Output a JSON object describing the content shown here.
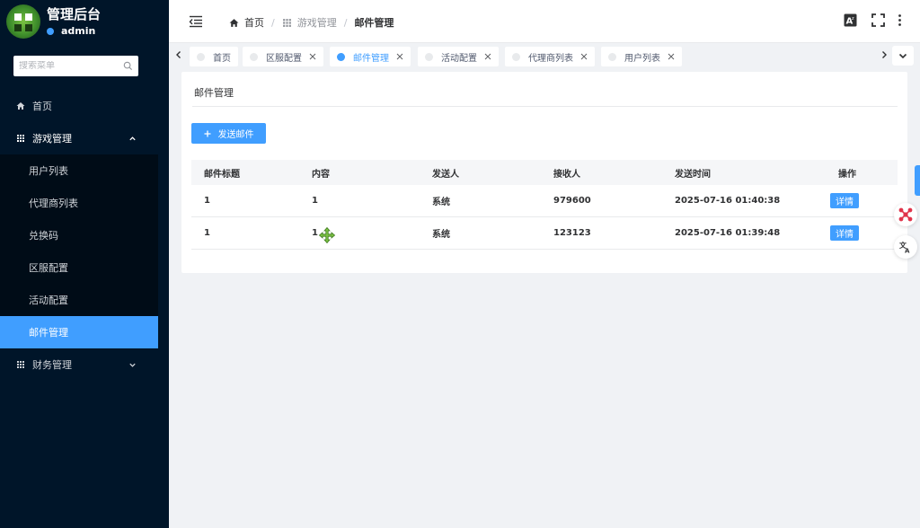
{
  "app": {
    "title": "管理后台",
    "username": "admin"
  },
  "sidebar": {
    "search_placeholder": "搜索菜单",
    "menu": [
      {
        "label": "首页",
        "icon": "home-icon"
      },
      {
        "label": "游戏管理",
        "icon": "grid-icon",
        "expanded": true,
        "children": [
          "用户列表",
          "代理商列表",
          "兑换码",
          "区服配置",
          "活动配置",
          "邮件管理"
        ],
        "active_child": "邮件管理"
      },
      {
        "label": "财务管理",
        "icon": "grid-icon",
        "expanded": false
      }
    ]
  },
  "header": {
    "breadcrumb": [
      "首页",
      "游戏管理",
      "邮件管理"
    ],
    "icons": [
      "translate-icon",
      "fullscreen-icon",
      "more-vertical-icon"
    ]
  },
  "tabs": [
    {
      "label": "首页",
      "closable": false,
      "active": false
    },
    {
      "label": "区服配置",
      "closable": true,
      "active": false
    },
    {
      "label": "邮件管理",
      "closable": true,
      "active": true
    },
    {
      "label": "活动配置",
      "closable": true,
      "active": false
    },
    {
      "label": "代理商列表",
      "closable": true,
      "active": false
    },
    {
      "label": "用户列表",
      "closable": true,
      "active": false
    }
  ],
  "page": {
    "title": "邮件管理",
    "send_button": "发送邮件",
    "table": {
      "columns": [
        "邮件标题",
        "内容",
        "发送人",
        "接收人",
        "发送时间",
        "操作"
      ],
      "rows": [
        {
          "title": "1",
          "content": "1",
          "sender": "系统",
          "receiver": "979600",
          "time": "2025-07-16 01:40:38",
          "action": "详情"
        },
        {
          "title": "1",
          "content": "1",
          "sender": "系统",
          "receiver": "123123",
          "time": "2025-07-16 01:39:48",
          "action": "详情"
        }
      ]
    }
  },
  "colors": {
    "sidebar_bg": "#001529",
    "accent": "#409eff"
  }
}
